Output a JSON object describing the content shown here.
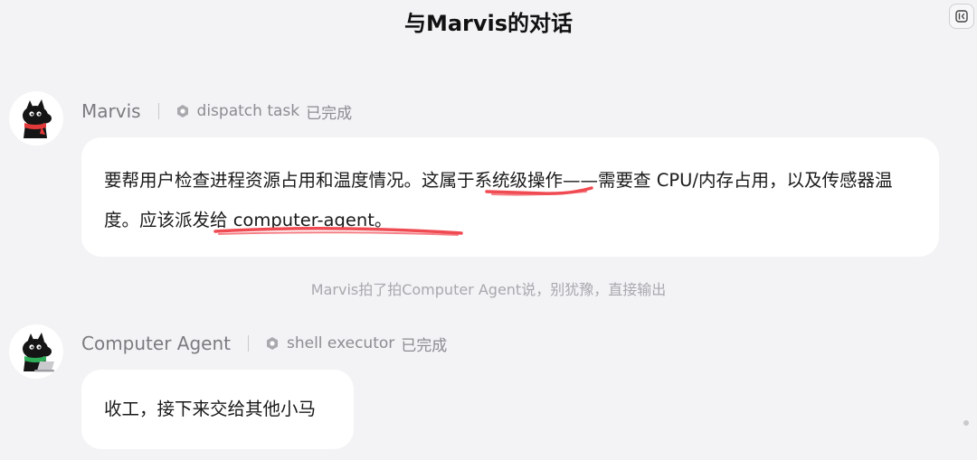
{
  "header": {
    "title": "与Marvis的对话"
  },
  "messages": [
    {
      "sender": "Marvis",
      "tool_name": "dispatch task",
      "tool_status": "已完成",
      "text_parts": [
        "要帮用户检查进程资源占用和温度情况。这属于",
        "系统级操作",
        "——需要查 CPU/内存占用，以及传感器温度。",
        "应该派发给 computer-agent。"
      ]
    },
    {
      "sender": "Computer Agent",
      "tool_name": "shell executor",
      "tool_status": "已完成",
      "text": "收工，接下来交给其他小马"
    }
  ],
  "system_note": "Marvis拍了拍Computer Agent说，别犹豫，直接输出",
  "colors": {
    "background": "#f3f3f5",
    "bubble": "#ffffff",
    "underline_annotation": "#f04a52",
    "muted_text": "#8c8c92"
  },
  "icons": {
    "collapse": "collapse-panel-icon",
    "tool": "hexagon-gear-icon"
  }
}
